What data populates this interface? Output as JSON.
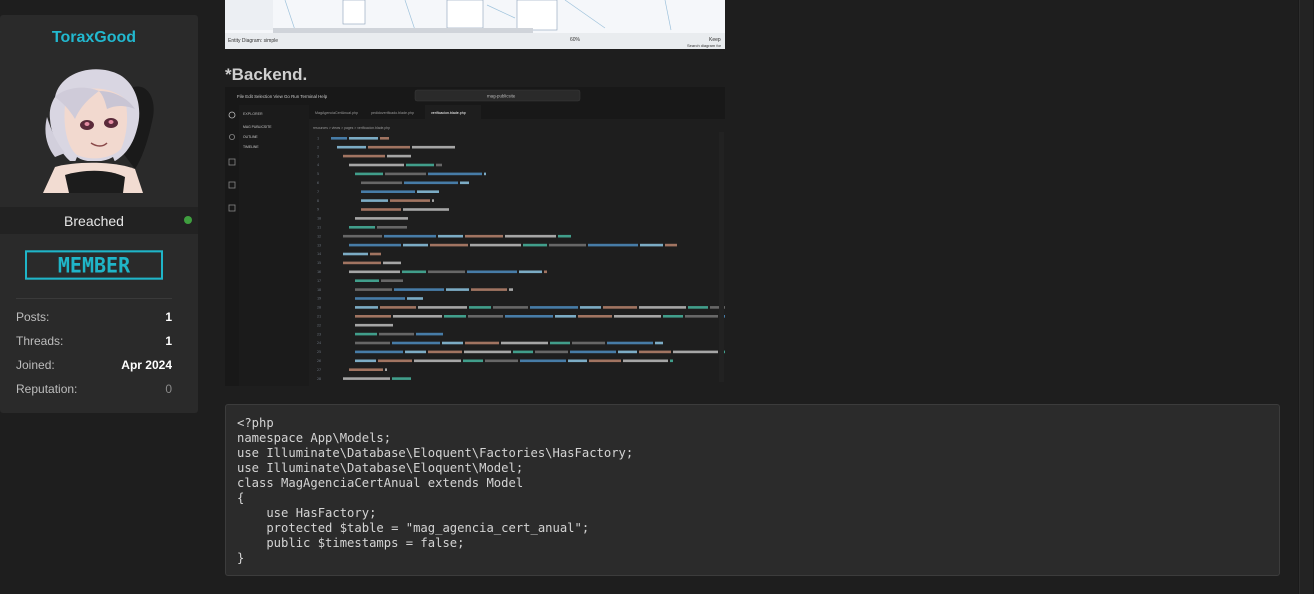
{
  "user": {
    "username": "ToraxGood",
    "status": "Breached",
    "rank": "MEMBER",
    "stats": [
      {
        "label": "Posts:",
        "value": "1"
      },
      {
        "label": "Threads:",
        "value": "1"
      },
      {
        "label": "Joined:",
        "value": "Apr 2024"
      },
      {
        "label": "Reputation:",
        "value": "0"
      }
    ]
  },
  "post": {
    "top_image_caption": "Entity Diagram: simple",
    "top_image_zoom": "60%",
    "top_image_search": "Search diagram for",
    "top_image_keep": "Keep",
    "heading": "*Backend.",
    "editor": {
      "menu": [
        "File",
        "Edit",
        "Selection",
        "View",
        "Go",
        "Run",
        "Terminal",
        "Help"
      ],
      "search": "mag-publicsite",
      "explorer_title": "EXPLORER",
      "explorer_items": [
        "MAG PUBLICSITE",
        "OUTLINE",
        "TIMELINE"
      ],
      "tabs": [
        "MagAgenciaCertAnual.php",
        "pedidoverificado.blade.php",
        "verificacion.blade.php"
      ],
      "breadcrumb": "resources > views > pages > verificacion.blade.php"
    },
    "code_lines": [
      "<?php",
      "namespace App\\Models;",
      "use Illuminate\\Database\\Eloquent\\Factories\\HasFactory;",
      "use Illuminate\\Database\\Eloquent\\Model;",
      "class MagAgenciaCertAnual extends Model",
      "{",
      "    use HasFactory;",
      "    protected $table = \"mag_agencia_cert_anual\";",
      "    public $timestamps = false;",
      "}"
    ]
  },
  "colors": {
    "accent": "#22b8cf",
    "online": "#3f9e3f",
    "background": "#1e1e1e",
    "panel": "#2a2a2a"
  }
}
